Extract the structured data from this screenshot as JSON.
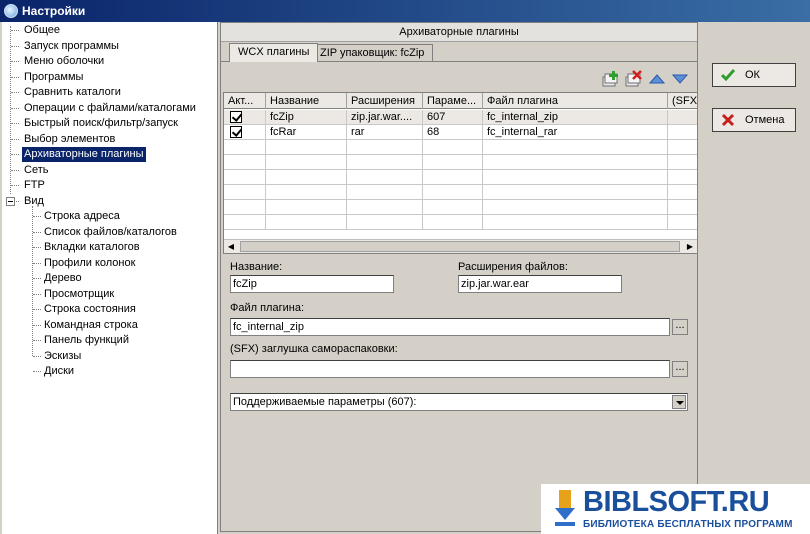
{
  "window": {
    "title": "Настройки"
  },
  "tree": {
    "items": [
      {
        "label": "Общее",
        "level": 0
      },
      {
        "label": "Запуск программы",
        "level": 0
      },
      {
        "label": "Меню оболочки",
        "level": 0
      },
      {
        "label": "Программы",
        "level": 0
      },
      {
        "label": "Сравнить каталоги",
        "level": 0
      },
      {
        "label": "Операции с файлами/каталогами",
        "level": 0
      },
      {
        "label": "Быстрый поиск/фильтр/запуск",
        "level": 0
      },
      {
        "label": "Выбор элементов",
        "level": 0
      },
      {
        "label": "Архиваторные плагины",
        "level": 0,
        "selected": true
      },
      {
        "label": "Сеть",
        "level": 0
      },
      {
        "label": "FTP",
        "level": 0
      },
      {
        "label": "Вид",
        "level": 0,
        "expander": true
      },
      {
        "label": "Строка адреса",
        "level": 1
      },
      {
        "label": "Список файлов/каталогов",
        "level": 1
      },
      {
        "label": "Вкладки каталогов",
        "level": 1
      },
      {
        "label": "Профили колонок",
        "level": 1
      },
      {
        "label": "Дерево",
        "level": 1
      },
      {
        "label": "Просмотрщик",
        "level": 1
      },
      {
        "label": "Строка состояния",
        "level": 1
      },
      {
        "label": "Командная строка",
        "level": 1
      },
      {
        "label": "Панель функций",
        "level": 1
      },
      {
        "label": "Эскизы",
        "level": 1
      },
      {
        "label": "Диски",
        "level": 1
      }
    ]
  },
  "panel": {
    "title": "Архиваторные плагины",
    "tabs": [
      {
        "label": "WCX плагины",
        "active": true
      },
      {
        "label": "ZIP упаковщик: fcZip",
        "active": false
      }
    ],
    "grid": {
      "columns": [
        "Акт...",
        "Название",
        "Расширения",
        "Параме...",
        "Файл плагина",
        "(SFX)"
      ],
      "rows": [
        {
          "checked": true,
          "name": "fcZip",
          "ext": "zip.jar.war....",
          "params": "607",
          "file": "fc_internal_zip",
          "sfx": ""
        },
        {
          "checked": true,
          "name": "fcRar",
          "ext": "rar",
          "params": "68",
          "file": "fc_internal_rar",
          "sfx": ""
        }
      ]
    },
    "form": {
      "name_label": "Название:",
      "name_value": "fcZip",
      "ext_label": "Расширения файлов:",
      "ext_value": "zip.jar.war.ear",
      "file_label": "Файл плагина:",
      "file_value": "fc_internal_zip",
      "sfx_label": "(SFX) заглушка самораспаковки:",
      "sfx_value": "",
      "browse_label": "...",
      "params_value": "Поддерживаемые параметры (607):"
    }
  },
  "buttons": {
    "ok_label": "ОК",
    "cancel_label": "Отмена"
  },
  "watermark": {
    "title": "BIBLSOFT.RU",
    "subtitle": "БИБЛИОТЕКА БЕСПЛАТНЫХ ПРОГРАММ"
  },
  "colors": {
    "selection": "#0a246a",
    "title_bar": "#0a246a",
    "ok_icon": "#2e9e2e",
    "cancel_icon": "#c81e1e",
    "brand": "#1a4f9c"
  }
}
